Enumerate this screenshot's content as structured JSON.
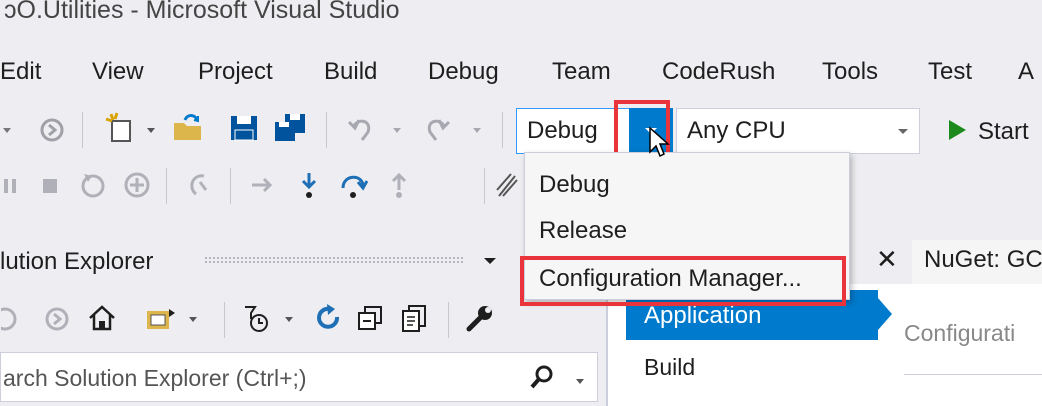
{
  "window": {
    "title": "GO.Utilities - Microsoft Visual Studio",
    "title_visible": "ɔO.Utilities - Microsoft Visual Studio"
  },
  "menu": {
    "items": [
      "Edit",
      "View",
      "Project",
      "Build",
      "Debug",
      "Team",
      "CodeRush",
      "Tools",
      "Test",
      "A"
    ]
  },
  "toolbar": {
    "config_value": "Debug",
    "platform_value": "Any CPU",
    "start_label": "Start"
  },
  "config_dropdown": {
    "options": [
      "Debug",
      "Release",
      "Configuration Manager..."
    ]
  },
  "solution_explorer": {
    "title": "lution Explorer",
    "search_placeholder": "arch Solution Explorer (Ctrl+;)"
  },
  "doc_tabs": {
    "nuget": "NuGet: GC"
  },
  "project_props": {
    "nav": [
      "Application",
      "Build"
    ],
    "section_label": "Configurati"
  },
  "colors": {
    "accent": "#007acc",
    "highlight": "#e8343a"
  }
}
